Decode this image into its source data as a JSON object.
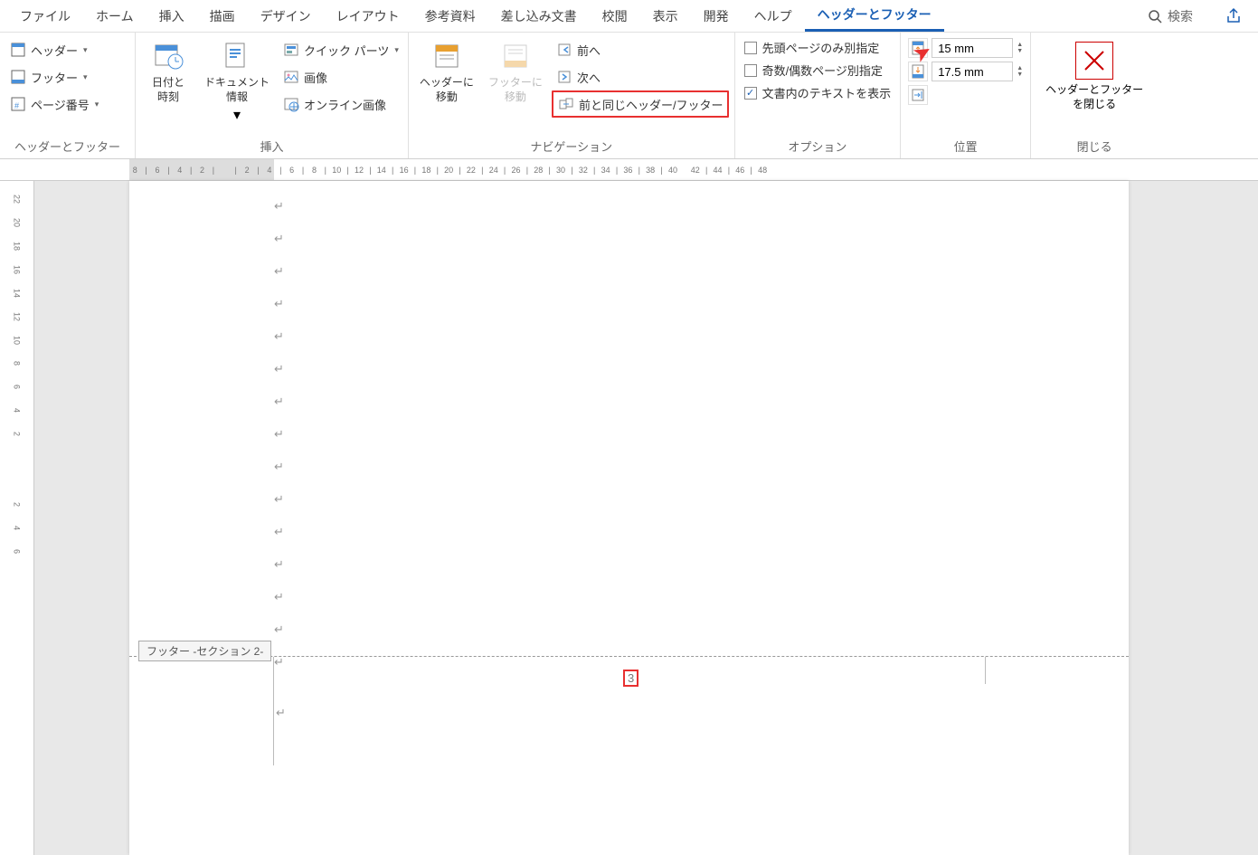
{
  "tabs": [
    "ファイル",
    "ホーム",
    "挿入",
    "描画",
    "デザイン",
    "レイアウト",
    "参考資料",
    "差し込み文書",
    "校閲",
    "表示",
    "開発",
    "ヘルプ",
    "ヘッダーとフッター"
  ],
  "active_tab_index": 12,
  "search": {
    "label": "検索"
  },
  "ribbon": {
    "grp_hf": {
      "label": "ヘッダーとフッター",
      "items": {
        "header": "ヘッダー",
        "footer": "フッター",
        "pagenum": "ページ番号"
      }
    },
    "grp_insert": {
      "label": "挿入",
      "datetime": "日付と\n時刻",
      "docinfo": "ドキュメント\n情報",
      "items": {
        "quick": "クイック パーツ",
        "image": "画像",
        "online": "オンライン画像"
      }
    },
    "grp_nav": {
      "label": "ナビゲーション",
      "goheader": "ヘッダーに\n移動",
      "gofooter": "フッターに\n移動",
      "items": {
        "prev": "前へ",
        "next": "次へ",
        "link": "前と同じヘッダー/フッター"
      }
    },
    "grp_opts": {
      "label": "オプション",
      "items": {
        "firstpage": "先頭ページのみ別指定",
        "oddeven": "奇数/偶数ページ別指定",
        "showtext": "文書内のテキストを表示"
      },
      "showtext_checked": "✓"
    },
    "grp_pos": {
      "label": "位置",
      "top_val": "15 mm",
      "bottom_val": "17.5 mm"
    },
    "grp_close": {
      "label": "閉じる",
      "btn": "ヘッダーとフッター\nを閉じる"
    }
  },
  "ruler": {
    "h_ticks": [
      "8",
      "|",
      "6",
      "|",
      "4",
      "|",
      "2",
      "|",
      "",
      "|",
      "2",
      "|",
      "4",
      "|",
      "6",
      "|",
      "8",
      "|",
      "10",
      "|",
      "12",
      "|",
      "14",
      "|",
      "16",
      "|",
      "18",
      "|",
      "20",
      "|",
      "22",
      "|",
      "24",
      "|",
      "26",
      "|",
      "28",
      "|",
      "30",
      "|",
      "32",
      "|",
      "34",
      "|",
      "36",
      "|",
      "38",
      "|",
      "40",
      "",
      "42",
      "|",
      "44",
      "|",
      "46",
      "|",
      "48"
    ],
    "v_ticks": [
      "",
      "22",
      "",
      "20",
      "",
      "18",
      "",
      "16",
      "",
      "14",
      "",
      "12",
      "",
      "10",
      "",
      "8",
      "",
      "6",
      "",
      "4",
      "",
      "2",
      "",
      "",
      "",
      "",
      "",
      "2",
      "",
      "4",
      "",
      "6"
    ]
  },
  "doc": {
    "para_mark": "↵",
    "para_count": 15,
    "footer_tag": "フッター -セクション 2-",
    "page_number": "3"
  }
}
